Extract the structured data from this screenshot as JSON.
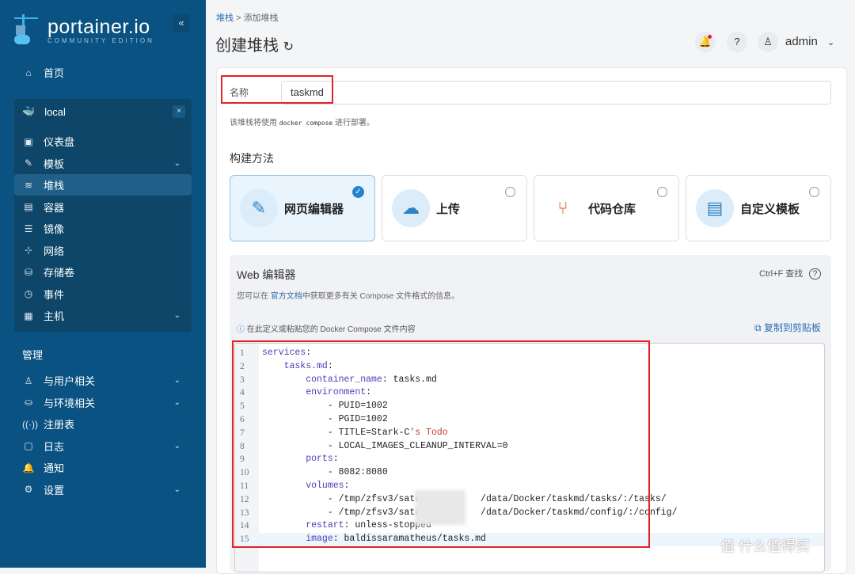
{
  "sidebar": {
    "logo_title": "portainer.io",
    "logo_subtitle": "COMMUNITY EDITION",
    "collapse": "«",
    "home": "首页",
    "env_name": "local",
    "env_close": "×",
    "env_items": [
      {
        "label": "仪表盘",
        "icon": "▣"
      },
      {
        "label": "模板",
        "icon": "✎",
        "chev": "⌄"
      },
      {
        "label": "堆栈",
        "icon": "≋"
      },
      {
        "label": "容器",
        "icon": "▤"
      },
      {
        "label": "镜像",
        "icon": "☰"
      },
      {
        "label": "网络",
        "icon": "⊹"
      },
      {
        "label": "存储卷",
        "icon": "⛁"
      },
      {
        "label": "事件",
        "icon": "◷"
      },
      {
        "label": "主机",
        "icon": "▦",
        "chev": "⌄"
      }
    ],
    "section": "管理",
    "admin_items": [
      {
        "label": "与用户相关",
        "icon": "♙",
        "chev": "⌄"
      },
      {
        "label": "与环境相关",
        "icon": "⛀",
        "chev": "⌄"
      },
      {
        "label": "注册表",
        "icon": "((·))"
      },
      {
        "label": "日志",
        "icon": "▢",
        "chev": "⌄"
      },
      {
        "label": "通知",
        "icon": "🔔"
      },
      {
        "label": "设置",
        "icon": "⚙",
        "chev": "⌄"
      }
    ]
  },
  "header": {
    "breadcrumb_link": "堆栈",
    "breadcrumb_sep": ">",
    "breadcrumb_current": "添加堆栈",
    "title": "创建堆栈",
    "refresh": "↻",
    "user": "admin"
  },
  "form": {
    "name_label": "名称",
    "name_value": "taskmd",
    "hint_pre": "该堆栈将使用",
    "hint_code": "docker compose",
    "hint_post": "进行部署。",
    "build_heading": "构建方法",
    "methods": [
      {
        "label": "网页编辑器",
        "icon": "✎",
        "selected": true
      },
      {
        "label": "上传",
        "icon": "☁"
      },
      {
        "label": "代码仓库",
        "icon": "⑂"
      },
      {
        "label": "自定义模板",
        "icon": "▤"
      }
    ],
    "check": "✓"
  },
  "editor": {
    "title": "Web 编辑器",
    "find": "Ctrl+F 查找",
    "desc_pre": "您可以在 ",
    "desc_link": "官方文档",
    "desc_post": "中获取更多有关 Compose 文件格式的信息。",
    "info_icon": "ⓘ",
    "info": "在此定义或粘贴您的 Docker Compose 文件内容",
    "copy": "⧉ 复制到剪贴板",
    "lines": [
      {
        "n": "1",
        "k": "services",
        "v": ":"
      },
      {
        "n": "2",
        "k": "    tasks.md",
        "v": ":"
      },
      {
        "n": "3",
        "k": "        container_name",
        "v": ": tasks.md"
      },
      {
        "n": "4",
        "k": "        environment",
        "v": ":"
      },
      {
        "n": "5",
        "k": "",
        "v": "            - PUID=1002"
      },
      {
        "n": "6",
        "k": "",
        "v": "            - PGID=1002"
      },
      {
        "n": "7",
        "k": "",
        "v": "            - TITLE=Stark-C",
        "s": "'s Todo"
      },
      {
        "n": "8",
        "k": "",
        "v": "            - LOCAL_IMAGES_CLEANUP_INTERVAL=0"
      },
      {
        "n": "9",
        "k": "        ports",
        "v": ":"
      },
      {
        "n": "10",
        "k": "",
        "v": "            - 8082:8080"
      },
      {
        "n": "11",
        "k": "        volumes",
        "v": ":"
      },
      {
        "n": "12",
        "k": "",
        "v": "            - /tmp/zfsv3/sata11/        /data/Docker/taskmd/tasks/:/tasks/"
      },
      {
        "n": "13",
        "k": "",
        "v": "            - /tmp/zfsv3/sata11/        /data/Docker/taskmd/config/:/config/"
      },
      {
        "n": "14",
        "k": "        restart",
        "v": ": unless-stopped"
      },
      {
        "n": "15",
        "k": "        image",
        "v": ": baldissaramatheus/tasks.md"
      }
    ]
  },
  "watermark": "值 什么值得买"
}
